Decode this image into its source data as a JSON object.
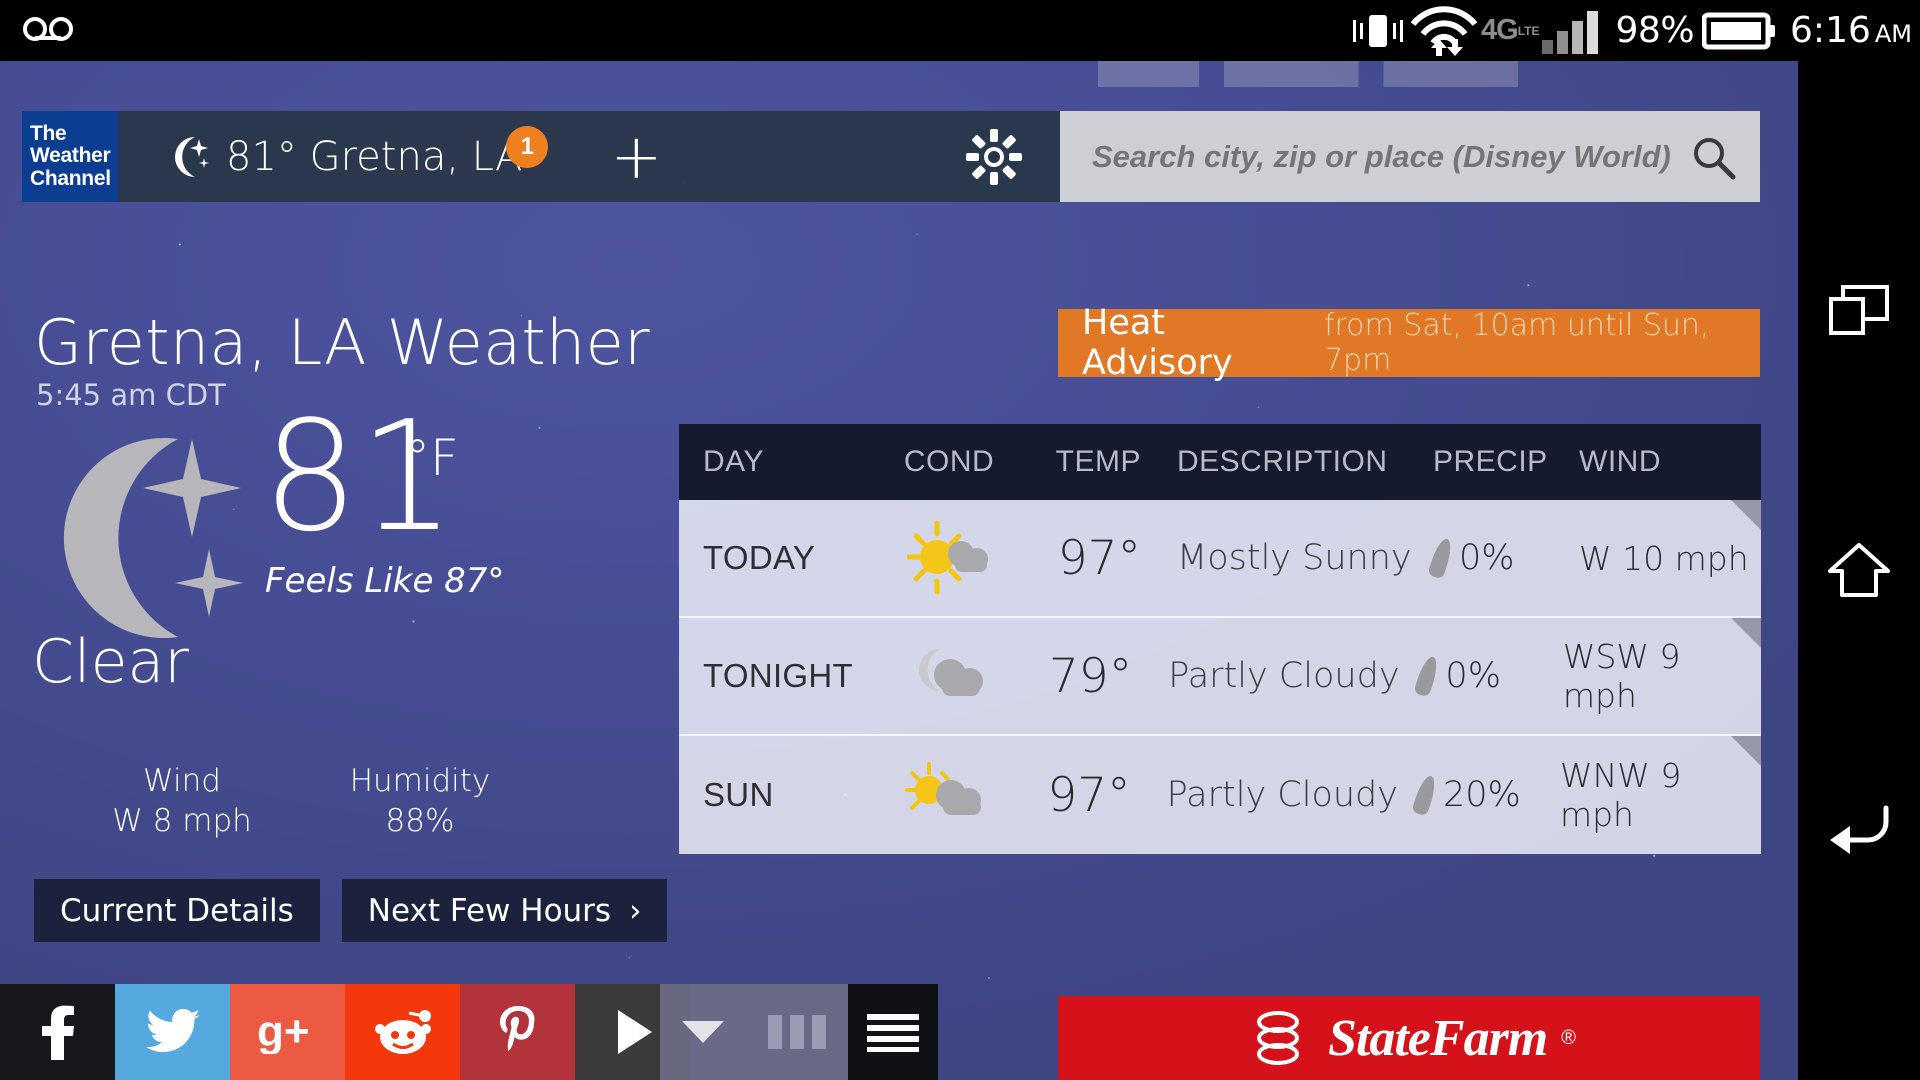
{
  "status_bar": {
    "voicemail_icon": "voicemail-icon",
    "vibrate_icon": "vibrate-icon",
    "wifi_icon": "wifi-transfer-icon",
    "network": "4G",
    "network_sup": "LTE",
    "signal_icon": "signal-bars-icon",
    "battery_percent": "98%",
    "battery_icon": "battery-icon",
    "time": "6:16",
    "ampm": "AM"
  },
  "app_bar": {
    "logo_line1": "The",
    "logo_line2": "Weather",
    "logo_line3": "Channel",
    "moon_icon": "moon-stars-icon",
    "location": "81° Gretna, LA",
    "badge_count": "1",
    "add_label": "+",
    "gear_icon": "gear-icon",
    "search_value": "",
    "search_placeholder": "Search city, zip or place (Disney World)",
    "search_icon": "search-icon"
  },
  "current": {
    "title": "Gretna, LA Weather",
    "observed_time": "5:45 am CDT",
    "moon_icon": "moon-stars-icon",
    "temperature": "81",
    "unit": "°F",
    "feels_like": "Feels Like 87°",
    "condition": "Clear",
    "wind_label": "Wind",
    "wind_value": "W 8 mph",
    "humidity_label": "Humidity",
    "humidity_value": "88%"
  },
  "buttons": {
    "current_details": "Current Details",
    "next_few_hours": "Next Few Hours",
    "chevron": "›"
  },
  "advisory": {
    "title": "Heat Advisory",
    "subtitle": "from Sat, 10am until Sun, 7pm",
    "color": "#e07826"
  },
  "forecast": {
    "columns": [
      "DAY",
      "COND",
      "TEMP",
      "DESCRIPTION",
      "PRECIP",
      "WIND"
    ],
    "rows": [
      {
        "day": "TODAY",
        "icon": "sun-cloud-icon",
        "temp": "97°",
        "desc": "Mostly Sunny",
        "precip": "0%",
        "wind": "W 10 mph"
      },
      {
        "day": "TONIGHT",
        "icon": "moon-cloud-icon",
        "temp": "79°",
        "desc": "Partly Cloudy",
        "precip": "0%",
        "wind": "WSW 9 mph"
      },
      {
        "day": "SUN",
        "icon": "sun-cloud-icon",
        "temp": "97°",
        "desc": "Partly Cloudy",
        "precip": "20%",
        "wind": "WNW 9 mph"
      }
    ]
  },
  "social": [
    {
      "name": "facebook-share-button",
      "glyph": "f",
      "color": "#16181c"
    },
    {
      "name": "twitter-share-button",
      "glyph": "t",
      "color": "#56a9de"
    },
    {
      "name": "googleplus-share-button",
      "glyph": "g+",
      "color": "#ed5a44"
    },
    {
      "name": "reddit-share-button",
      "glyph": "r",
      "color": "#f5380c"
    },
    {
      "name": "pinterest-share-button",
      "glyph": "p",
      "color": "#b3333a"
    },
    {
      "name": "more-share-button",
      "glyph": "▶",
      "color": "#3b3b3b"
    }
  ],
  "player": {
    "collapse_icon": "chevron-down-icon",
    "columns_icon": "columns-icon",
    "menu_icon": "menu-icon"
  },
  "ad": {
    "brand": "StateFarm",
    "registered": "®",
    "color": "#d5121a"
  },
  "nav": {
    "recents_icon": "recents-icon",
    "home_icon": "home-icon",
    "back_icon": "back-icon"
  }
}
